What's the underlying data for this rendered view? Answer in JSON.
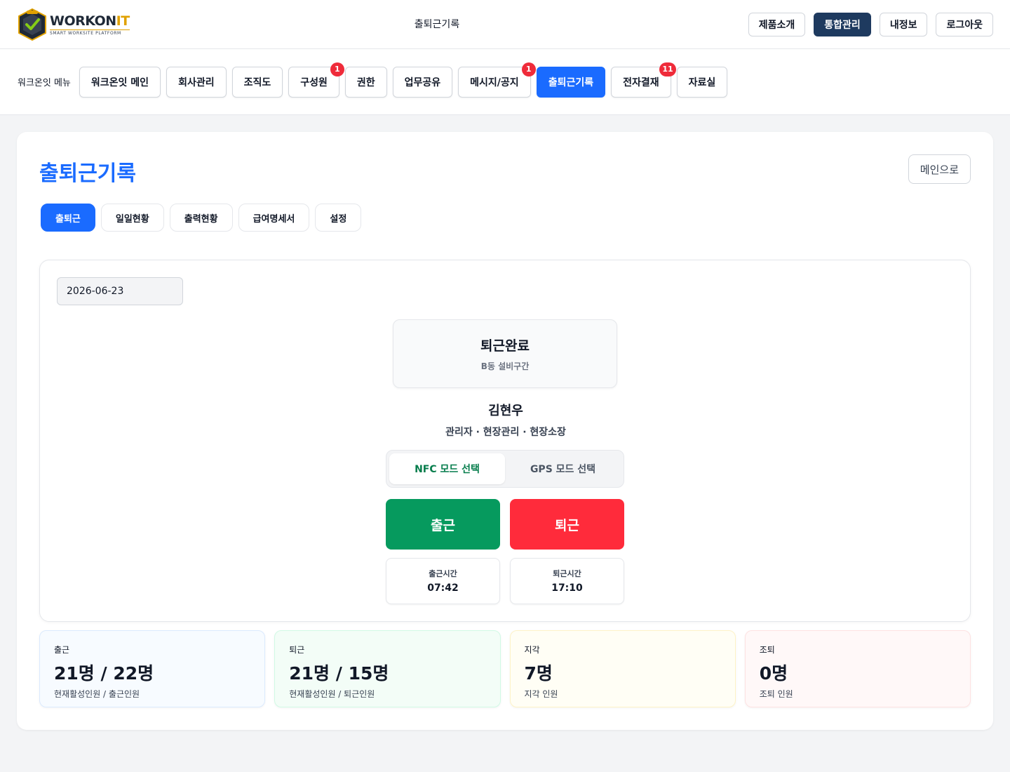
{
  "header": {
    "logo_word_main": "WORKON",
    "logo_word_accent": "IT",
    "logo_tagline": "SMART WORKSITE PLATFORM",
    "title": "출퇴근기록",
    "buttons": [
      {
        "label": "제품소개"
      },
      {
        "label": "통합관리"
      },
      {
        "label": "내정보"
      },
      {
        "label": "로그아웃"
      }
    ]
  },
  "menu": {
    "label": "워크온잇 메뉴",
    "items": [
      {
        "label": "워크온잇 메인",
        "badge": ""
      },
      {
        "label": "회사관리",
        "badge": ""
      },
      {
        "label": "조직도",
        "badge": ""
      },
      {
        "label": "구성원",
        "badge": "1"
      },
      {
        "label": "권한",
        "badge": ""
      },
      {
        "label": "업무공유",
        "badge": ""
      },
      {
        "label": "메시지/공지",
        "badge": "1"
      },
      {
        "label": "출퇴근기록",
        "badge": ""
      },
      {
        "label": "전자결재",
        "badge": "11"
      },
      {
        "label": "자료실",
        "badge": ""
      }
    ],
    "active": "출퇴근기록"
  },
  "page": {
    "title": "출퇴근기록",
    "back_label": "메인으로",
    "subtabs": [
      {
        "label": "출퇴근"
      },
      {
        "label": "일일현황"
      },
      {
        "label": "출력현황"
      },
      {
        "label": "급여명세서"
      },
      {
        "label": "설정"
      }
    ]
  },
  "attendance": {
    "date": "2026-06-23",
    "status_title": "퇴근완료",
    "status_location": "B동 설비구간",
    "person_name": "김현우",
    "person_role": "관리자 · 현장관리 · 현장소장",
    "modes": [
      {
        "label": "NFC 모드 선택",
        "selected": true
      },
      {
        "label": "GPS 모드 선택",
        "selected": false
      }
    ],
    "clock_in_label": "출근",
    "clock_out_label": "퇴근",
    "clock_in_time_label": "출근시간",
    "clock_in_time": "07:42",
    "clock_out_time_label": "퇴근시간",
    "clock_out_time": "17:10"
  },
  "stats": [
    {
      "label": "출근",
      "value": "21명 / 22명",
      "desc": "현재활성인원 / 출근인원",
      "bg": "#f7fbff",
      "border": "#dbeafe"
    },
    {
      "label": "퇴근",
      "value": "21명 / 15명",
      "desc": "현재활성인원 / 퇴근인원",
      "bg": "#f3fdf7",
      "border": "#d1fae5"
    },
    {
      "label": "지각",
      "value": "7명",
      "desc": "지각 인원",
      "bg": "#fffef5",
      "border": "#fef3c7"
    },
    {
      "label": "조퇴",
      "value": "0명",
      "desc": "조퇴 인원",
      "bg": "#fff8f8",
      "border": "#fee2e2"
    }
  ],
  "colors": {
    "accent": "#1a6bff",
    "header_primary": "#1e3a5f",
    "clock_in": "#069a5e",
    "clock_out": "#ff2b3b",
    "badge": "#ef2b3a"
  }
}
